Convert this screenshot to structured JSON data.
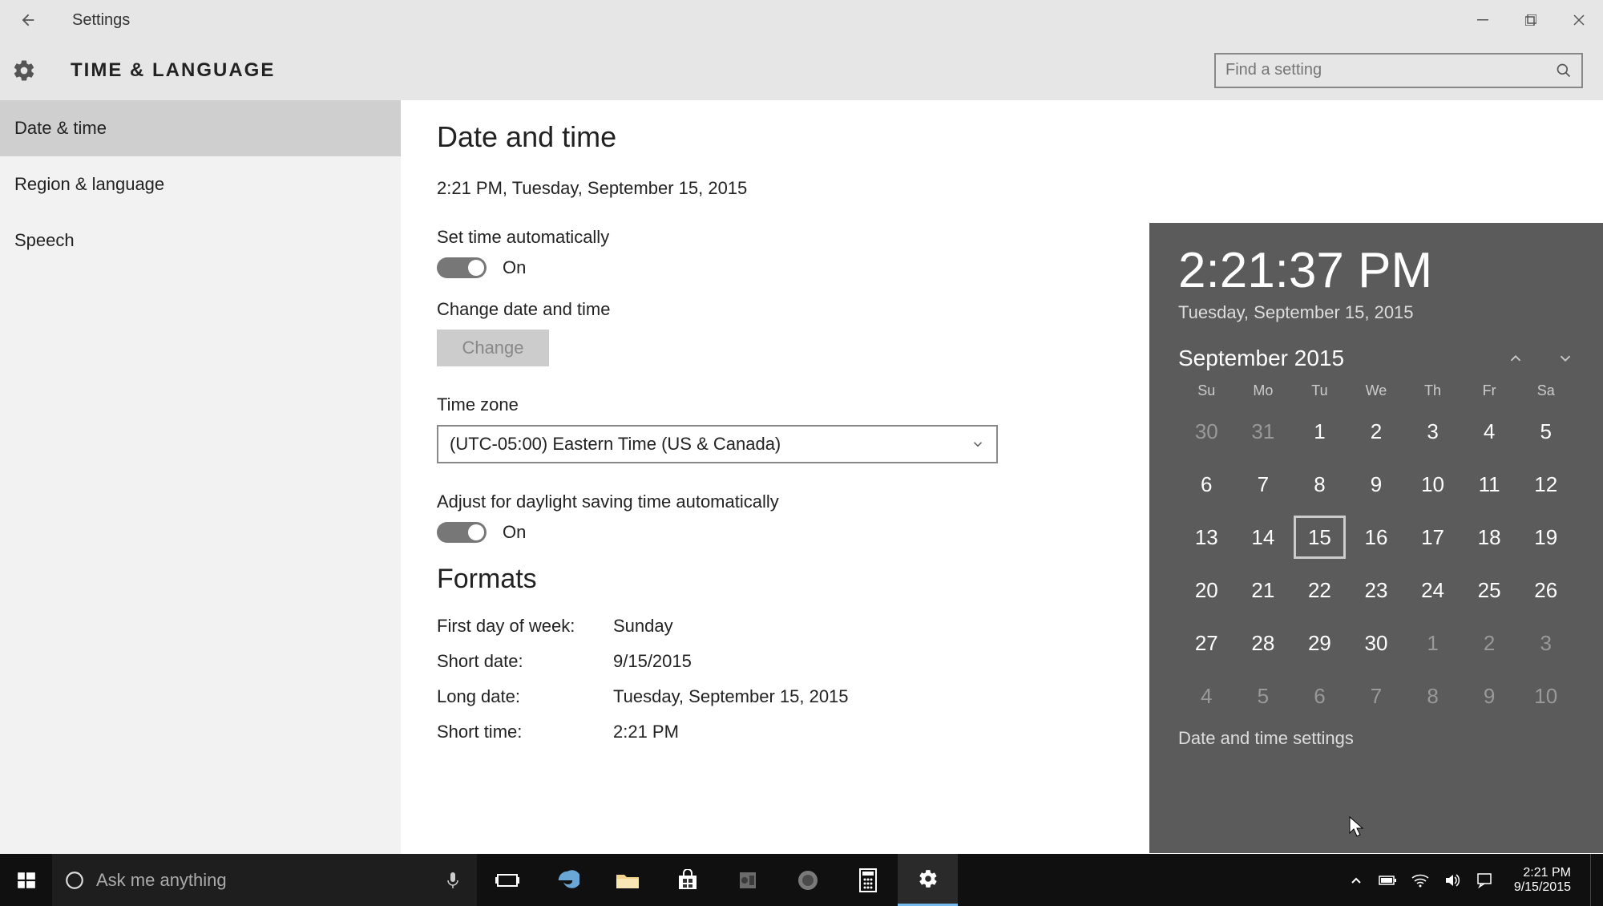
{
  "titlebar": {
    "title": "Settings"
  },
  "header": {
    "title": "TIME & LANGUAGE",
    "search_placeholder": "Find a setting"
  },
  "sidebar": {
    "items": [
      {
        "label": "Date & time",
        "active": true
      },
      {
        "label": "Region & language",
        "active": false
      },
      {
        "label": "Speech",
        "active": false
      }
    ]
  },
  "main": {
    "heading": "Date and time",
    "current": "2:21 PM, Tuesday, September 15, 2015",
    "set_auto_label": "Set time automatically",
    "set_auto_state": "On",
    "change_label": "Change date and time",
    "change_button": "Change",
    "tz_label": "Time zone",
    "tz_value": "(UTC-05:00) Eastern Time (US & Canada)",
    "dst_label": "Adjust for daylight saving time automatically",
    "dst_state": "On",
    "formats_heading": "Formats",
    "formats": [
      {
        "k": "First day of week:",
        "v": "Sunday"
      },
      {
        "k": "Short date:",
        "v": "9/15/2015"
      },
      {
        "k": "Long date:",
        "v": "Tuesday, September 15, 2015"
      },
      {
        "k": "Short time:",
        "v": "2:21 PM"
      }
    ]
  },
  "flyout": {
    "time": "2:21:37 PM",
    "date": "Tuesday, September 15, 2015",
    "month": "September 2015",
    "dow": [
      "Su",
      "Mo",
      "Tu",
      "We",
      "Th",
      "Fr",
      "Sa"
    ],
    "weeks": [
      [
        {
          "n": "30",
          "dim": true
        },
        {
          "n": "31",
          "dim": true
        },
        {
          "n": "1"
        },
        {
          "n": "2"
        },
        {
          "n": "3"
        },
        {
          "n": "4"
        },
        {
          "n": "5"
        }
      ],
      [
        {
          "n": "6"
        },
        {
          "n": "7"
        },
        {
          "n": "8"
        },
        {
          "n": "9"
        },
        {
          "n": "10"
        },
        {
          "n": "11"
        },
        {
          "n": "12"
        }
      ],
      [
        {
          "n": "13"
        },
        {
          "n": "14"
        },
        {
          "n": "15",
          "today": true
        },
        {
          "n": "16"
        },
        {
          "n": "17"
        },
        {
          "n": "18"
        },
        {
          "n": "19"
        }
      ],
      [
        {
          "n": "20"
        },
        {
          "n": "21"
        },
        {
          "n": "22"
        },
        {
          "n": "23"
        },
        {
          "n": "24"
        },
        {
          "n": "25"
        },
        {
          "n": "26"
        }
      ],
      [
        {
          "n": "27"
        },
        {
          "n": "28"
        },
        {
          "n": "29"
        },
        {
          "n": "30"
        },
        {
          "n": "1",
          "dim": true
        },
        {
          "n": "2",
          "dim": true
        },
        {
          "n": "3",
          "dim": true
        }
      ],
      [
        {
          "n": "4",
          "dim": true
        },
        {
          "n": "5",
          "dim": true
        },
        {
          "n": "6",
          "dim": true
        },
        {
          "n": "7",
          "dim": true
        },
        {
          "n": "8",
          "dim": true
        },
        {
          "n": "9",
          "dim": true
        },
        {
          "n": "10",
          "dim": true
        }
      ]
    ],
    "link": "Date and time settings"
  },
  "taskbar": {
    "search_placeholder": "Ask me anything",
    "clock_time": "2:21 PM",
    "clock_date": "9/15/2015"
  }
}
